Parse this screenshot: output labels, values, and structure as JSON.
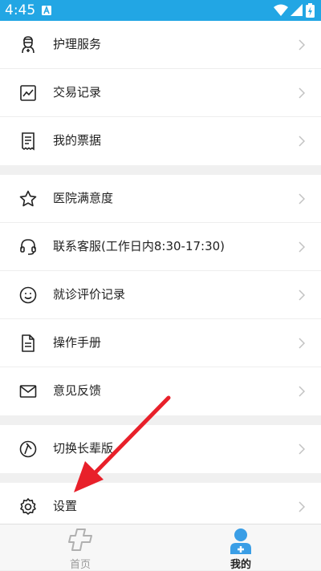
{
  "status_bar": {
    "time": "4:45",
    "icons": [
      "notification-a-icon",
      "wifi-icon",
      "signal-icon",
      "battery-charging-icon"
    ]
  },
  "menu": {
    "items": [
      {
        "label": "护理服务",
        "icon": "nurse-icon"
      },
      {
        "label": "交易记录",
        "icon": "trend-chart-icon"
      },
      {
        "label": "我的票据",
        "icon": "receipt-icon"
      },
      {
        "label": "医院满意度",
        "icon": "star-icon"
      },
      {
        "label": "联系客服(工作日内8:30-17:30)",
        "icon": "headset-icon"
      },
      {
        "label": "就诊评价记录",
        "icon": "smiley-icon"
      },
      {
        "label": "操作手册",
        "icon": "document-icon"
      },
      {
        "label": "意见反馈",
        "icon": "mail-icon"
      },
      {
        "label": "切换长辈版",
        "icon": "switch-elder-icon"
      },
      {
        "label": "设置",
        "icon": "gear-icon"
      }
    ]
  },
  "tab_bar": {
    "tabs": [
      {
        "label": "首页",
        "icon": "medical-cross-icon",
        "active": false
      },
      {
        "label": "我的",
        "icon": "user-profile-icon",
        "active": true
      }
    ]
  },
  "colors": {
    "status_bar": "#22a6e4",
    "accent": "#3a9ee6",
    "annotation_arrow": "#e8202a"
  }
}
